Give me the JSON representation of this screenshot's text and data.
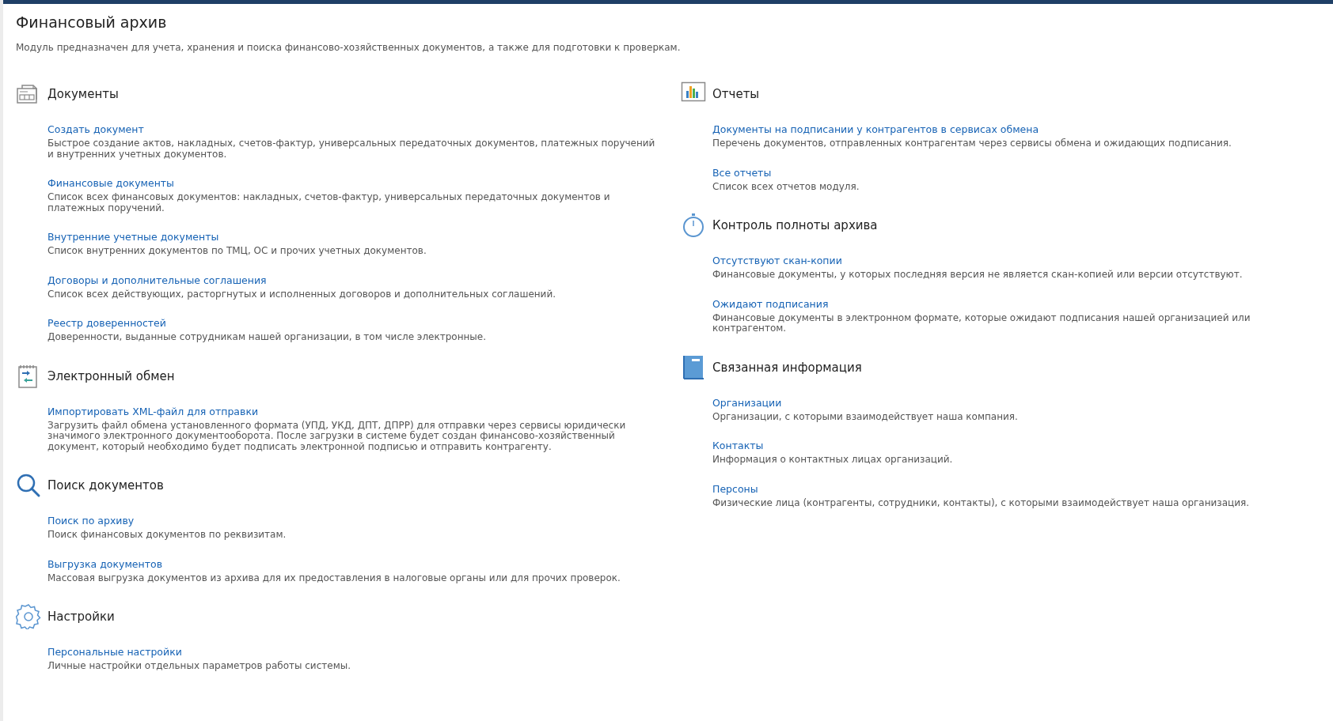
{
  "title": "Финансовый архив",
  "subtitle": "Модуль предназначен для учета, хранения и поиска финансово-хозяйственных документов, а также для подготовки к проверкам.",
  "columns": [
    {
      "sections": [
        {
          "kind": "documents",
          "title": "Документы",
          "items": [
            {
              "link": "Создать документ",
              "description": "Быстрое создание актов, накладных, счетов-фактур, универсальных передаточных документов, платежных поручений и внутренних учетных документов."
            },
            {
              "link": "Финансовые документы",
              "description": "Список всех финансовых документов: накладных, счетов-фактур, универсальных передаточных документов и платежных поручений."
            },
            {
              "link": "Внутренние учетные документы",
              "description": "Список внутренних документов по ТМЦ, ОС и прочих учетных документов."
            },
            {
              "link": "Договоры и дополнительные соглашения",
              "description": "Список всех действующих, расторгнутых и исполненных договоров и дополнительных соглашений."
            },
            {
              "link": "Реестр доверенностей",
              "description": "Доверенности, выданные сотрудникам нашей организации, в том числе электронные."
            }
          ]
        },
        {
          "kind": "exchange",
          "title": "Электронный обмен",
          "items": [
            {
              "link": "Импортировать XML-файл для отправки",
              "description": "Загрузить файл обмена установленного формата (УПД, УКД, ДПТ, ДПРР) для отправки через сервисы юридически значимого электронного документооборота. После загрузки в системе будет создан финансово-хозяйственный документ, который необходимо будет подписать электронной подписью и отправить контрагенту."
            }
          ]
        },
        {
          "kind": "search",
          "title": "Поиск документов",
          "items": [
            {
              "link": "Поиск по архиву",
              "description": "Поиск финансовых документов по реквизитам."
            },
            {
              "link": "Выгрузка документов",
              "description": "Массовая выгрузка документов из архива для их предоставления в налоговые органы или для прочих проверок."
            }
          ]
        },
        {
          "kind": "settings",
          "title": "Настройки",
          "items": [
            {
              "link": "Персональные настройки",
              "description": "Личные настройки отдельных параметров работы системы."
            }
          ]
        }
      ]
    },
    {
      "sections": [
        {
          "kind": "reports",
          "title": "Отчеты",
          "items": [
            {
              "link": "Документы на подписании у контрагентов в сервисах обмена",
              "description": "Перечень документов, отправленных контрагентам через сервисы обмена и ожидающих подписания."
            },
            {
              "link": "Все отчеты",
              "description": "Список всех отчетов модуля."
            }
          ]
        },
        {
          "kind": "control",
          "title": "Контроль полноты архива",
          "items": [
            {
              "link": "Отсутствуют скан-копии",
              "description": "Финансовые документы, у которых последняя версия не является скан-копией или версии отсутствуют."
            },
            {
              "link": "Ожидают подписания",
              "description": "Финансовые документы в электронном формате, которые ожидают подписания нашей организацией или контрагентом."
            }
          ]
        },
        {
          "kind": "related",
          "title": "Связанная информация",
          "items": [
            {
              "link": "Организации",
              "description": "Организации, с которыми взаимодействует наша компания."
            },
            {
              "link": "Контакты",
              "description": "Информация о контактных лицах организаций."
            },
            {
              "link": "Персоны",
              "description": "Физические лица (контрагенты, сотрудники, контакты), с которыми взаимодействует наша организация."
            }
          ]
        }
      ]
    }
  ]
}
